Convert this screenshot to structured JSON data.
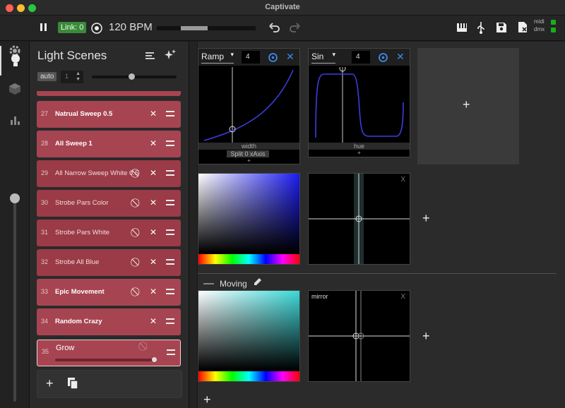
{
  "window": {
    "title": "Captivate"
  },
  "traffic": {
    "close": "#ff5f57",
    "minimize": "#febc2e",
    "zoom": "#28c840"
  },
  "toolbar": {
    "link_label": "Link: 0",
    "bpm_label": "120 BPM",
    "status": {
      "midi": "midi",
      "dmx": "dmx"
    },
    "status_color": "#18b018"
  },
  "scene_panel": {
    "title": "Light Scenes",
    "auto_label": "auto",
    "auto_value": "1",
    "scenes": [
      {
        "num": "27",
        "name": "Natrual Sweep 0.5",
        "dim": false
      },
      {
        "num": "28",
        "name": "All Sweep 1",
        "dim": false
      },
      {
        "num": "29",
        "name": "All Narrow Sweep White 0.5",
        "dim": true
      },
      {
        "num": "30",
        "name": "Strobe Pars Color",
        "dim": true
      },
      {
        "num": "31",
        "name": "Strobe Pars White",
        "dim": true
      },
      {
        "num": "32",
        "name": "Strobe All Blue",
        "dim": true
      },
      {
        "num": "33",
        "name": "Epic Movement",
        "dim": false
      },
      {
        "num": "34",
        "name": "Random Crazy",
        "dim": false
      },
      {
        "num": "35",
        "name": "Grow",
        "dim": false
      }
    ],
    "accent": "#a64551"
  },
  "modulators": [
    {
      "shape": "Ramp",
      "count": "4",
      "param_label": "width",
      "split_label": "Split 0 xAxis",
      "plus": "+"
    },
    {
      "shape": "Sin",
      "count": "4",
      "param_label": "hue",
      "plus": "+"
    }
  ],
  "groups": {
    "moving_label": "Moving",
    "pad_mirror_label": "mirror",
    "pad_close": "X",
    "add": "+"
  }
}
